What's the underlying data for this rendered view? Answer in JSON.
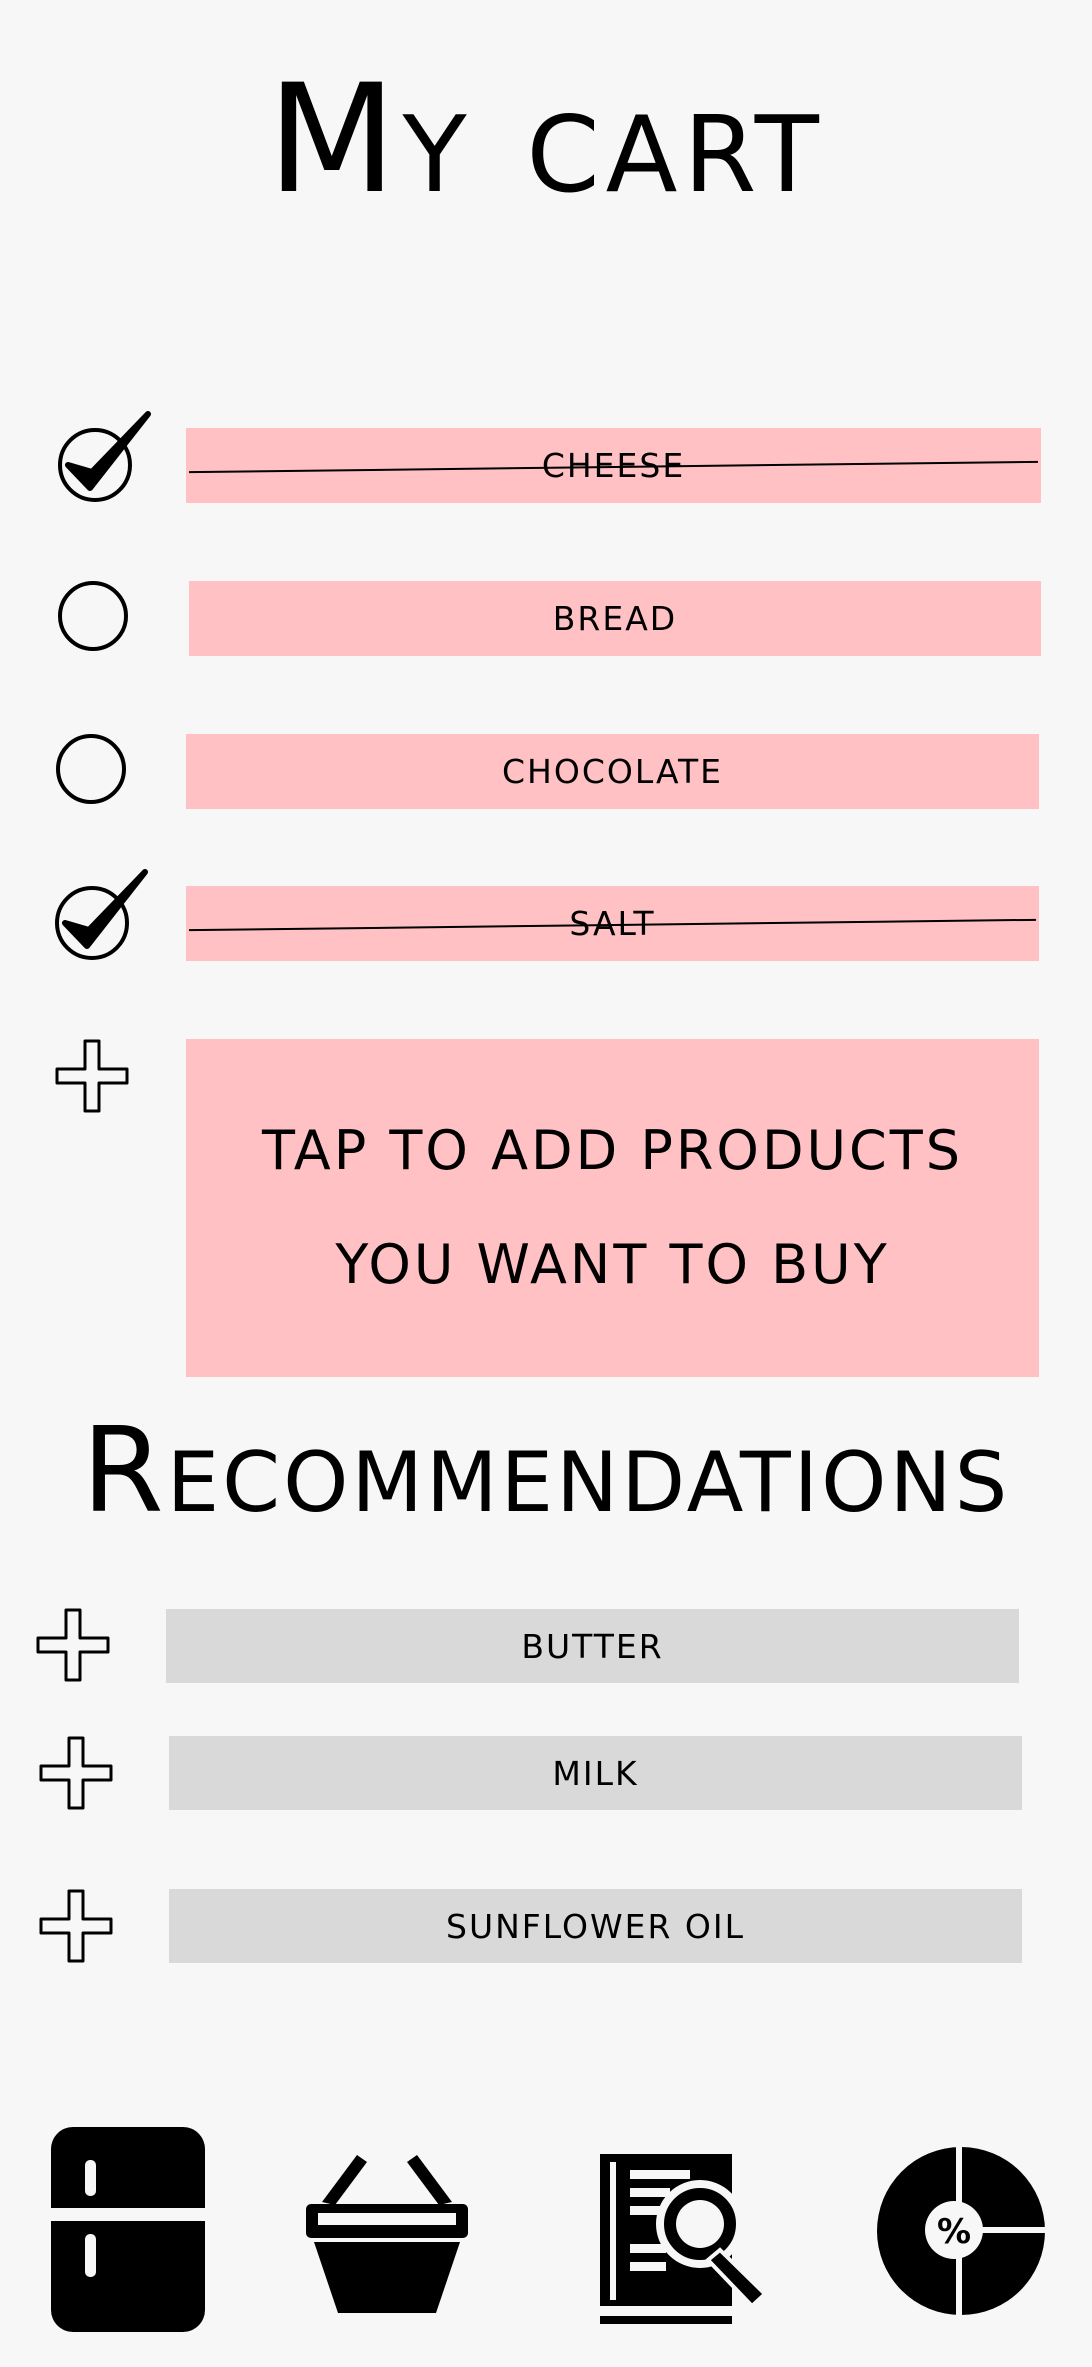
{
  "header": {
    "title": "My cart"
  },
  "cart": {
    "items": [
      {
        "label": "CHEESE",
        "checked": true
      },
      {
        "label": "BREAD",
        "checked": false
      },
      {
        "label": "CHOCOLATE",
        "checked": false
      },
      {
        "label": "SALT",
        "checked": true
      }
    ],
    "add_prompt": {
      "line1": "TAP TO ADD PRODUCTS",
      "line2": "YOU WANT TO BUY"
    }
  },
  "recommendations": {
    "title": "Recommendations",
    "items": [
      {
        "label": "BUTTER"
      },
      {
        "label": "MILK"
      },
      {
        "label": "SUNFLOWER OIL"
      }
    ]
  },
  "bottom_nav": {
    "items": [
      {
        "icon": "fridge-icon"
      },
      {
        "icon": "basket-icon"
      },
      {
        "icon": "recipe-search-icon"
      },
      {
        "icon": "discount-pie-icon"
      }
    ]
  },
  "colors": {
    "cart_item_bg": "#ffc1c3",
    "recommendation_bg": "#d9d9d9",
    "page_bg": "#f7f7f7"
  }
}
